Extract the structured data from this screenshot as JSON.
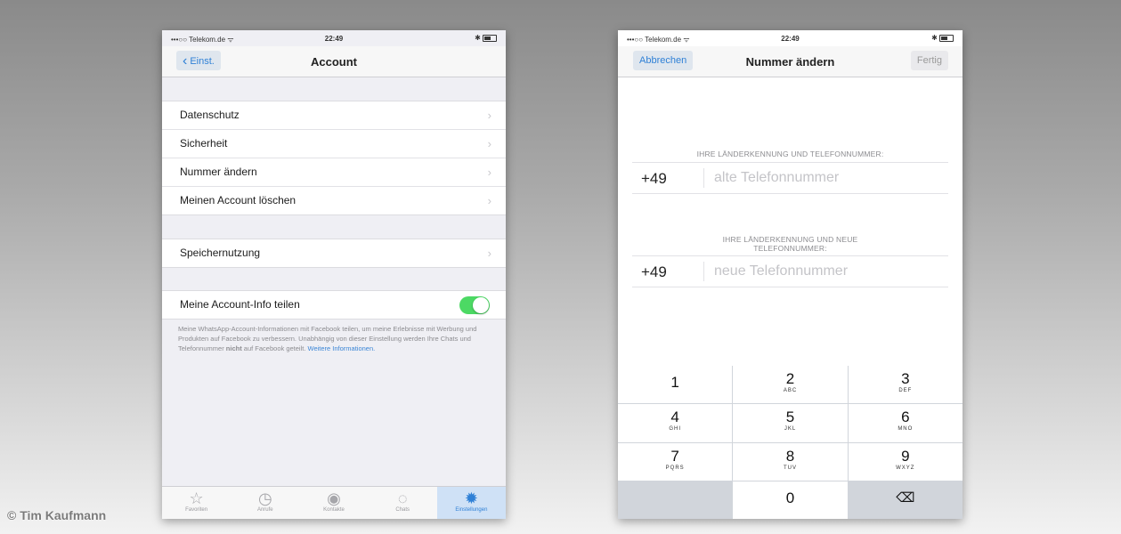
{
  "phone1": {
    "status": {
      "carrier": "•••○○ Telekom.de ᯤ",
      "time": "22:49"
    },
    "nav": {
      "back_label": "Einst.",
      "title": "Account"
    },
    "group1": [
      {
        "label": "Datenschutz"
      },
      {
        "label": "Sicherheit"
      },
      {
        "label": "Nummer ändern"
      },
      {
        "label": "Meinen Account löschen"
      }
    ],
    "group2": [
      {
        "label": "Speichernutzung"
      }
    ],
    "share": {
      "label": "Meine Account-Info teilen",
      "enabled": true,
      "toggle_color": "#4cd964"
    },
    "footnote": {
      "part1": "Meine WhatsApp-Account-Informationen mit Facebook teilen, um meine Erlebnisse mit Werbung und Produkten auf Facebook zu verbessern. Unabhängig von dieser Einstellung werden Ihre Chats und Telefonnummer ",
      "bold": "nicht",
      "part2": " auf Facebook geteilt. ",
      "link": "Weitere Informationen."
    },
    "tabbar": [
      {
        "label": "Favoriten",
        "icon": "star-icon"
      },
      {
        "label": "Anrufe",
        "icon": "clock-icon"
      },
      {
        "label": "Kontakte",
        "icon": "person-icon"
      },
      {
        "label": "Chats",
        "icon": "chat-bubbles-icon"
      },
      {
        "label": "Einstellungen",
        "icon": "gear-icon",
        "active": true
      }
    ]
  },
  "phone2": {
    "status": {
      "carrier": "•••○○ Telekom.de ᯤ",
      "time": "22:49"
    },
    "nav": {
      "cancel_label": "Abbrechen",
      "title": "Nummer ändern",
      "done_label": "Fertig"
    },
    "old_section": {
      "header": "IHRE LÄNDERKENNUNG UND TELEFONNUMMER:",
      "country_code": "+49",
      "placeholder": "alte Telefonnummer"
    },
    "new_section": {
      "header_line1": "IHRE LÄNDERKENNUNG UND NEUE",
      "header_line2": "TELEFONNUMMER:",
      "country_code": "+49",
      "placeholder": "neue Telefonnummer"
    },
    "keypad": [
      {
        "num": "1",
        "letters": ""
      },
      {
        "num": "2",
        "letters": "ABC"
      },
      {
        "num": "3",
        "letters": "DEF"
      },
      {
        "num": "4",
        "letters": "GHI"
      },
      {
        "num": "5",
        "letters": "JKL"
      },
      {
        "num": "6",
        "letters": "MNO"
      },
      {
        "num": "7",
        "letters": "PQRS"
      },
      {
        "num": "8",
        "letters": "TUV"
      },
      {
        "num": "9",
        "letters": "WXYZ"
      },
      {
        "num": "0",
        "letters": ""
      }
    ],
    "delete_icon": "backspace-icon"
  },
  "watermark": "© Tim Kaufmann"
}
